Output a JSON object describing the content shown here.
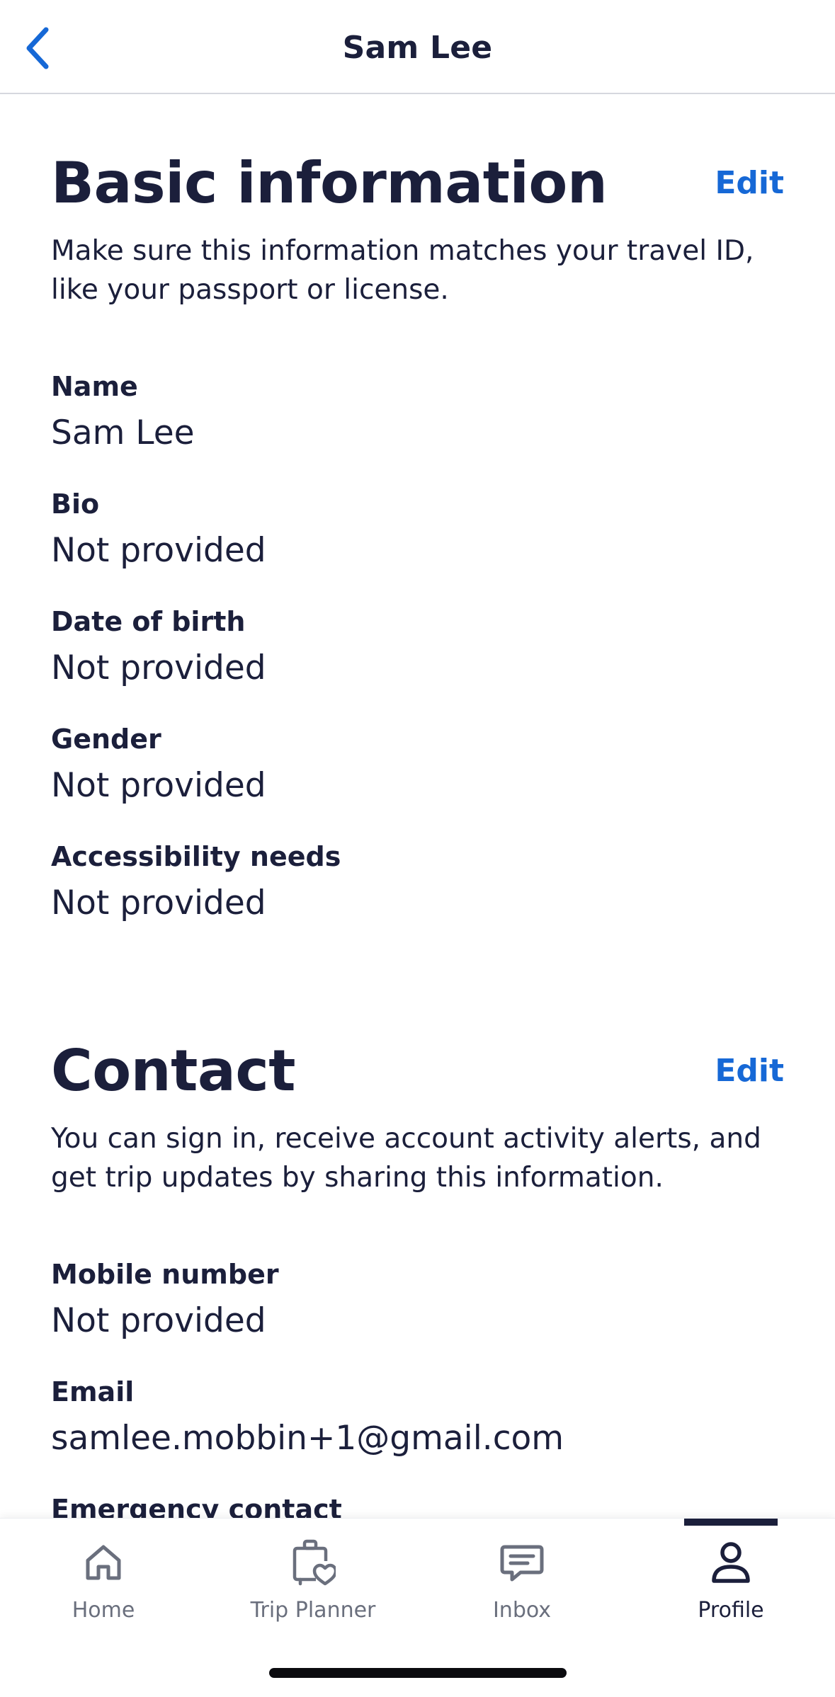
{
  "header": {
    "title": "Sam Lee",
    "back_icon": "chevron-left-icon"
  },
  "basic_info": {
    "title": "Basic information",
    "edit_label": "Edit",
    "description": "Make sure this information matches your travel ID, like your passport or license.",
    "fields": [
      {
        "label": "Name",
        "value": "Sam Lee"
      },
      {
        "label": "Bio",
        "value": "Not provided"
      },
      {
        "label": "Date of birth",
        "value": "Not provided"
      },
      {
        "label": "Gender",
        "value": "Not provided"
      },
      {
        "label": "Accessibility needs",
        "value": "Not provided"
      }
    ]
  },
  "contact": {
    "title": "Contact",
    "edit_label": "Edit",
    "description": "You can sign in, receive account activity alerts, and get trip updates by sharing this information.",
    "fields": [
      {
        "label": "Mobile number",
        "value": "Not provided"
      },
      {
        "label": "Email",
        "value": "samlee.mobbin+1@gmail.com"
      },
      {
        "label": "Emergency contact",
        "value": ""
      }
    ]
  },
  "tabbar": {
    "items": [
      {
        "label": "Home",
        "icon": "home-icon"
      },
      {
        "label": "Trip Planner",
        "icon": "suitcase-heart-icon"
      },
      {
        "label": "Inbox",
        "icon": "chat-bubble-icon"
      },
      {
        "label": "Profile",
        "icon": "person-icon"
      }
    ],
    "active": "Profile"
  },
  "colors": {
    "text": "#1b1f3b",
    "link": "#1668d6",
    "muted": "#6a6f7d"
  }
}
